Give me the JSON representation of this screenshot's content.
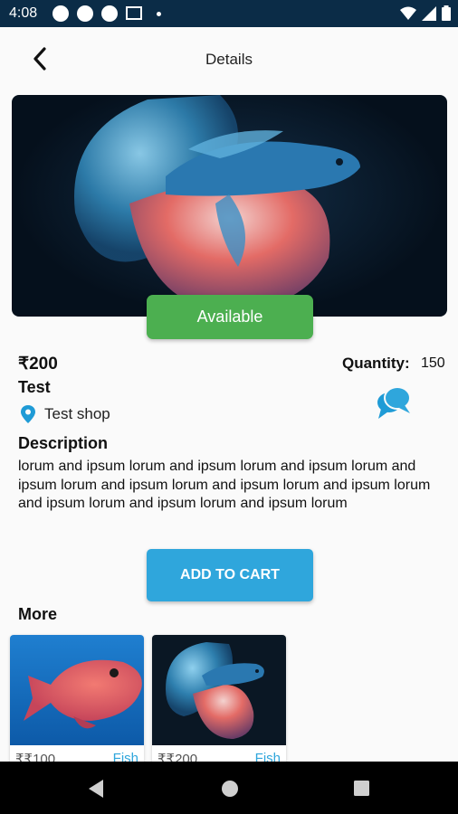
{
  "status_bar": {
    "time": "4:08"
  },
  "header": {
    "title": "Details"
  },
  "product": {
    "availability": "Available",
    "price": "₹200",
    "quantity_label": "Quantity:",
    "quantity_value": "150",
    "name": "Test",
    "shop": "Test shop",
    "description_title": "Description",
    "description": "lorum and ipsum lorum and ipsum lorum and ipsum lorum and ipsum lorum and ipsum lorum and ipsum lorum and ipsum lorum and ipsum lorum and ipsum lorum and ipsum lorum"
  },
  "cart_button": "ADD TO CART",
  "more": {
    "title": "More",
    "items": [
      {
        "price": "₹₹100",
        "category": "Fish"
      },
      {
        "price": "₹₹200",
        "category": "Fish"
      }
    ]
  },
  "colors": {
    "status_bar": "#0b2c47",
    "available": "#4caf50",
    "accent": "#2fa6dc"
  }
}
